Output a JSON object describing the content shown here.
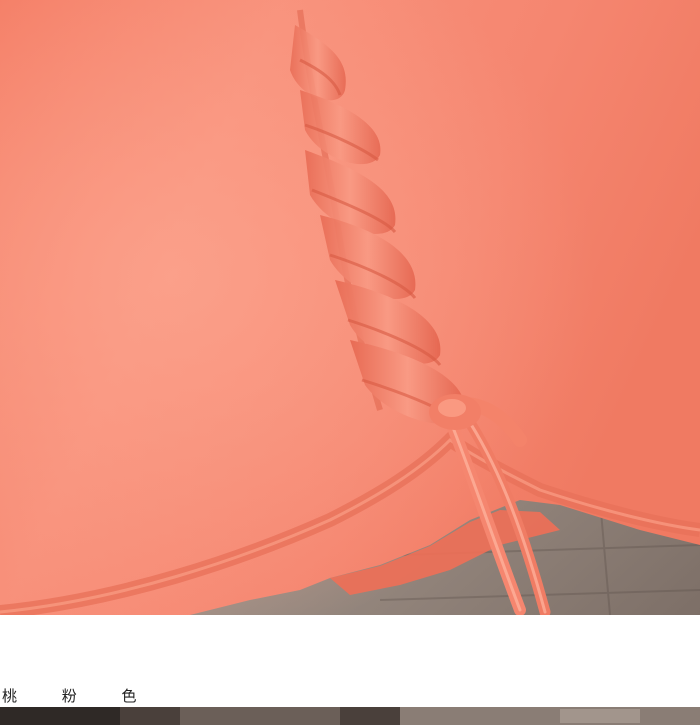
{
  "caption": {
    "color_name": "桃 粉 色"
  },
  "colors": {
    "fabric": "#f4836a",
    "fabric_shadow": "#e56a52",
    "fabric_highlight": "#fb9c84",
    "background_wall": "#8c7d74",
    "strip_dark": "#3a3330"
  }
}
